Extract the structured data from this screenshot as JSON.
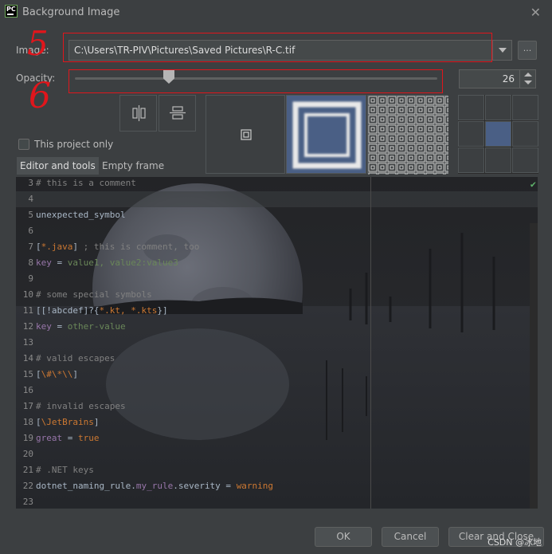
{
  "window": {
    "app_icon_text": "PC",
    "title": "Background Image"
  },
  "image": {
    "label": "Image:",
    "path": "C:\\Users\\TR-PIV\\Pictures\\Saved Pictures\\R-C.tif",
    "browse_label": "..."
  },
  "opacity": {
    "label": "Opacity:",
    "value": "26",
    "fraction": 0.26
  },
  "options": {
    "this_project_only": "This project only"
  },
  "tabs": [
    {
      "label": "Editor and tools"
    },
    {
      "label": "Empty frame"
    }
  ],
  "annotations": {
    "mark_image": "5",
    "mark_opacity": "6"
  },
  "code_lines": [
    {
      "n": "3",
      "parts": [
        {
          "t": "# this is a comment",
          "c": "comment"
        }
      ]
    },
    {
      "n": "4",
      "parts": []
    },
    {
      "n": "5",
      "parts": [
        {
          "t": "unexpected_symbol",
          "c": "plain"
        }
      ]
    },
    {
      "n": "6",
      "parts": []
    },
    {
      "n": "7",
      "parts": [
        {
          "t": "[",
          "c": "plain"
        },
        {
          "t": "*.java",
          "c": "str"
        },
        {
          "t": "] ",
          "c": "plain"
        },
        {
          "t": "; this is comment, too",
          "c": "comment"
        }
      ]
    },
    {
      "n": "8",
      "parts": [
        {
          "t": "key",
          "c": "key"
        },
        {
          "t": " = ",
          "c": "plain"
        },
        {
          "t": "value1, value2:value3",
          "c": "val"
        }
      ]
    },
    {
      "n": "9",
      "parts": []
    },
    {
      "n": "10",
      "parts": [
        {
          "t": "# some special symbols",
          "c": "comment"
        }
      ]
    },
    {
      "n": "11",
      "parts": [
        {
          "t": "[[!abcdef]?{",
          "c": "plain"
        },
        {
          "t": "*.kt, *.kts",
          "c": "str"
        },
        {
          "t": "}]",
          "c": "plain"
        }
      ]
    },
    {
      "n": "12",
      "parts": [
        {
          "t": "key",
          "c": "key"
        },
        {
          "t": " = ",
          "c": "plain"
        },
        {
          "t": "other-value",
          "c": "val"
        }
      ]
    },
    {
      "n": "13",
      "parts": []
    },
    {
      "n": "14",
      "parts": [
        {
          "t": "# valid escapes",
          "c": "comment"
        }
      ]
    },
    {
      "n": "15",
      "parts": [
        {
          "t": "[",
          "c": "plain"
        },
        {
          "t": "\\#\\*\\\\",
          "c": "str"
        },
        {
          "t": "]",
          "c": "plain"
        }
      ]
    },
    {
      "n": "16",
      "parts": []
    },
    {
      "n": "17",
      "parts": [
        {
          "t": "# invalid escapes",
          "c": "comment"
        }
      ]
    },
    {
      "n": "18",
      "parts": [
        {
          "t": "[",
          "c": "plain"
        },
        {
          "t": "\\J",
          "c": "str"
        },
        {
          "t": "etBrains",
          "c": "str"
        },
        {
          "t": "]",
          "c": "plain"
        }
      ]
    },
    {
      "n": "19",
      "parts": [
        {
          "t": "great",
          "c": "key"
        },
        {
          "t": " = ",
          "c": "plain"
        },
        {
          "t": "true",
          "c": "bool"
        }
      ]
    },
    {
      "n": "20",
      "parts": []
    },
    {
      "n": "21",
      "parts": [
        {
          "t": "# .NET keys",
          "c": "comment"
        }
      ]
    },
    {
      "n": "22",
      "parts": [
        {
          "t": "dotnet_naming_rule",
          "c": "plain"
        },
        {
          "t": ".",
          "c": "plain"
        },
        {
          "t": "my_rule",
          "c": "key"
        },
        {
          "t": ".severity",
          "c": "plain"
        },
        {
          "t": " = ",
          "c": "plain"
        },
        {
          "t": "warning",
          "c": "str"
        }
      ]
    },
    {
      "n": "23",
      "parts": []
    }
  ],
  "buttons": {
    "ok": "OK",
    "cancel": "Cancel",
    "clear_close": "Clear and Close"
  },
  "watermark": "CSDN @冰地",
  "colors": {
    "accent": "#4a5f85",
    "annotation_red": "#e0161c",
    "background": "#3c3f41"
  }
}
